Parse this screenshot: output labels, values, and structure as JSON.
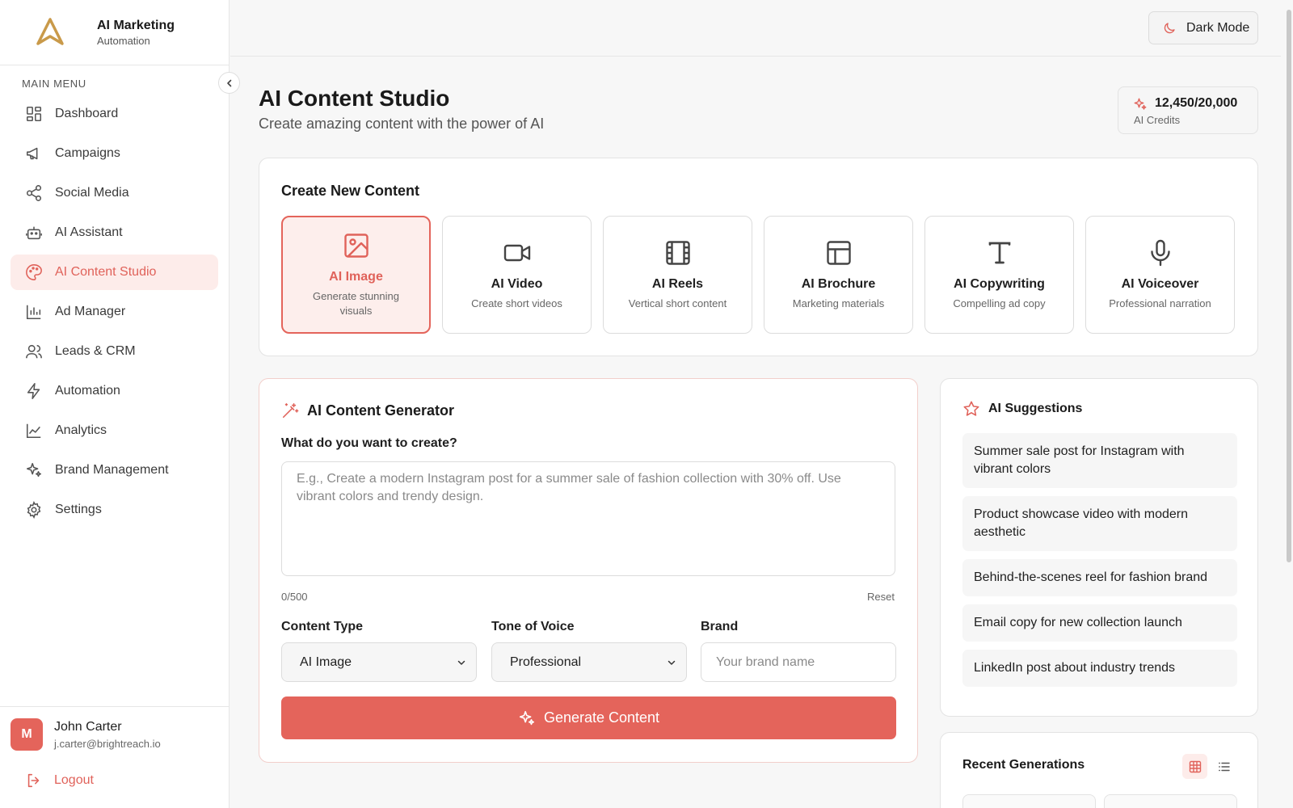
{
  "app": {
    "name": "AI Marketing",
    "subtitle": "Automation"
  },
  "sidebar": {
    "menu_label": "MAIN MENU",
    "items": [
      {
        "label": "Dashboard",
        "icon": "grid-icon"
      },
      {
        "label": "Campaigns",
        "icon": "megaphone-icon"
      },
      {
        "label": "Social Media",
        "icon": "share-icon"
      },
      {
        "label": "AI Assistant",
        "icon": "robot-icon"
      },
      {
        "label": "AI Content Studio",
        "icon": "palette-icon",
        "active": true
      },
      {
        "label": "Ad Manager",
        "icon": "bar-chart-icon"
      },
      {
        "label": "Leads & CRM",
        "icon": "users-icon"
      },
      {
        "label": "Automation",
        "icon": "lightning-icon"
      },
      {
        "label": "Analytics",
        "icon": "line-chart-icon"
      },
      {
        "label": "Brand Management",
        "icon": "sparkles-icon"
      },
      {
        "label": "Settings",
        "icon": "gear-icon"
      }
    ]
  },
  "user": {
    "initial": "M",
    "name": "John Carter",
    "email": "j.carter@brightreach.io",
    "logout_label": "Logout"
  },
  "topbar": {
    "dark_mode_label": "Dark Mode"
  },
  "header": {
    "title": "AI Content Studio",
    "subtitle": "Create amazing content with the power of AI",
    "credits_value": "12,450/20,000",
    "credits_label": "AI Credits"
  },
  "create": {
    "heading": "Create New Content",
    "tiles": [
      {
        "name": "AI Image",
        "desc": "Generate stunning visuals",
        "icon": "image-icon",
        "active": true
      },
      {
        "name": "AI Video",
        "desc": "Create short videos",
        "icon": "video-camera-icon"
      },
      {
        "name": "AI Reels",
        "desc": "Vertical short content",
        "icon": "film-icon"
      },
      {
        "name": "AI Brochure",
        "desc": "Marketing materials",
        "icon": "layout-icon"
      },
      {
        "name": "AI Copywriting",
        "desc": "Compelling ad copy",
        "icon": "text-icon"
      },
      {
        "name": "AI Voiceover",
        "desc": "Professional narration",
        "icon": "microphone-icon"
      }
    ]
  },
  "generator": {
    "heading": "AI Content Generator",
    "prompt_label": "What do you want to create?",
    "prompt_value": "",
    "prompt_placeholder": "E.g., Create a modern Instagram post for a summer sale of fashion collection with 30% off. Use vibrant colors and trendy design.",
    "char_count": "0/500",
    "reset_label": "Reset",
    "content_type_label": "Content Type",
    "content_type_value": "AI Image",
    "tone_label": "Tone of Voice",
    "tone_value": "Professional",
    "brand_label": "Brand",
    "brand_value": "",
    "brand_placeholder": "Your brand name",
    "generate_label": "Generate Content"
  },
  "suggestions": {
    "heading": "AI Suggestions",
    "items": [
      "Summer sale post for Instagram with vibrant colors",
      "Product showcase video with modern aesthetic",
      "Behind-the-scenes reel for fashion brand",
      "Email copy for new collection launch",
      "LinkedIn post about industry trends"
    ]
  },
  "recent": {
    "heading": "Recent Generations"
  },
  "colors": {
    "accent": "#e4645b",
    "accent_soft": "#fdecea",
    "logo_gold": "#c99a4a"
  }
}
